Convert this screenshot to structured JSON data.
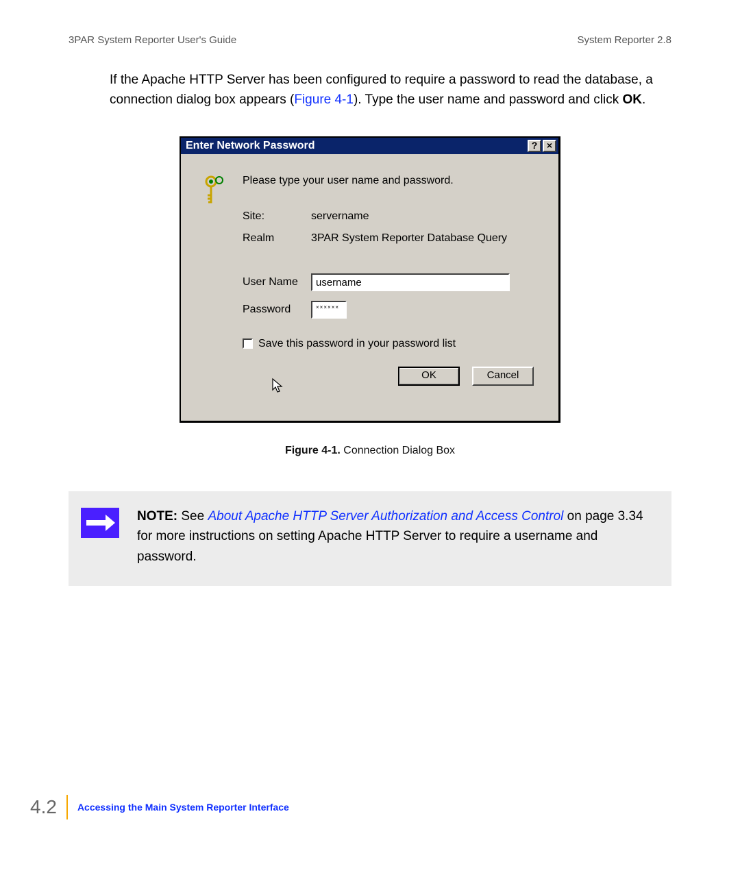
{
  "header": {
    "left": "3PAR System Reporter User's Guide",
    "right": "System Reporter 2.8"
  },
  "body": {
    "para_pre": "If the Apache HTTP Server has been configured to require a password to read the database, a connection dialog box appears (",
    "figref": "Figure 4-1",
    "para_mid": "). Type the user name and password and click ",
    "ok_bold": "OK",
    "para_end": "."
  },
  "dialog": {
    "title": "Enter Network Password",
    "help_btn": "?",
    "close_btn": "×",
    "prompt": "Please type your user name and password.",
    "site_label": "Site:",
    "site_value": "servername",
    "realm_label": "Realm",
    "realm_value": "3PAR System Reporter Database Query",
    "user_label": "User Name",
    "user_value": "username",
    "pass_label": "Password",
    "pass_value": "××××××",
    "save_check": "Save this password in your password list",
    "ok": "OK",
    "cancel": "Cancel"
  },
  "caption": {
    "bold": "Figure 4-1.",
    "rest": "  Connection Dialog Box"
  },
  "note": {
    "lead": "NOTE:",
    "see": " See ",
    "link": "About Apache HTTP Server Authorization and Access Control",
    "tail": " on page 3.34 for more instructions on setting Apache HTTP Server to require a username and password."
  },
  "footer": {
    "num": "4.2",
    "title": "Accessing the Main System Reporter Interface"
  }
}
